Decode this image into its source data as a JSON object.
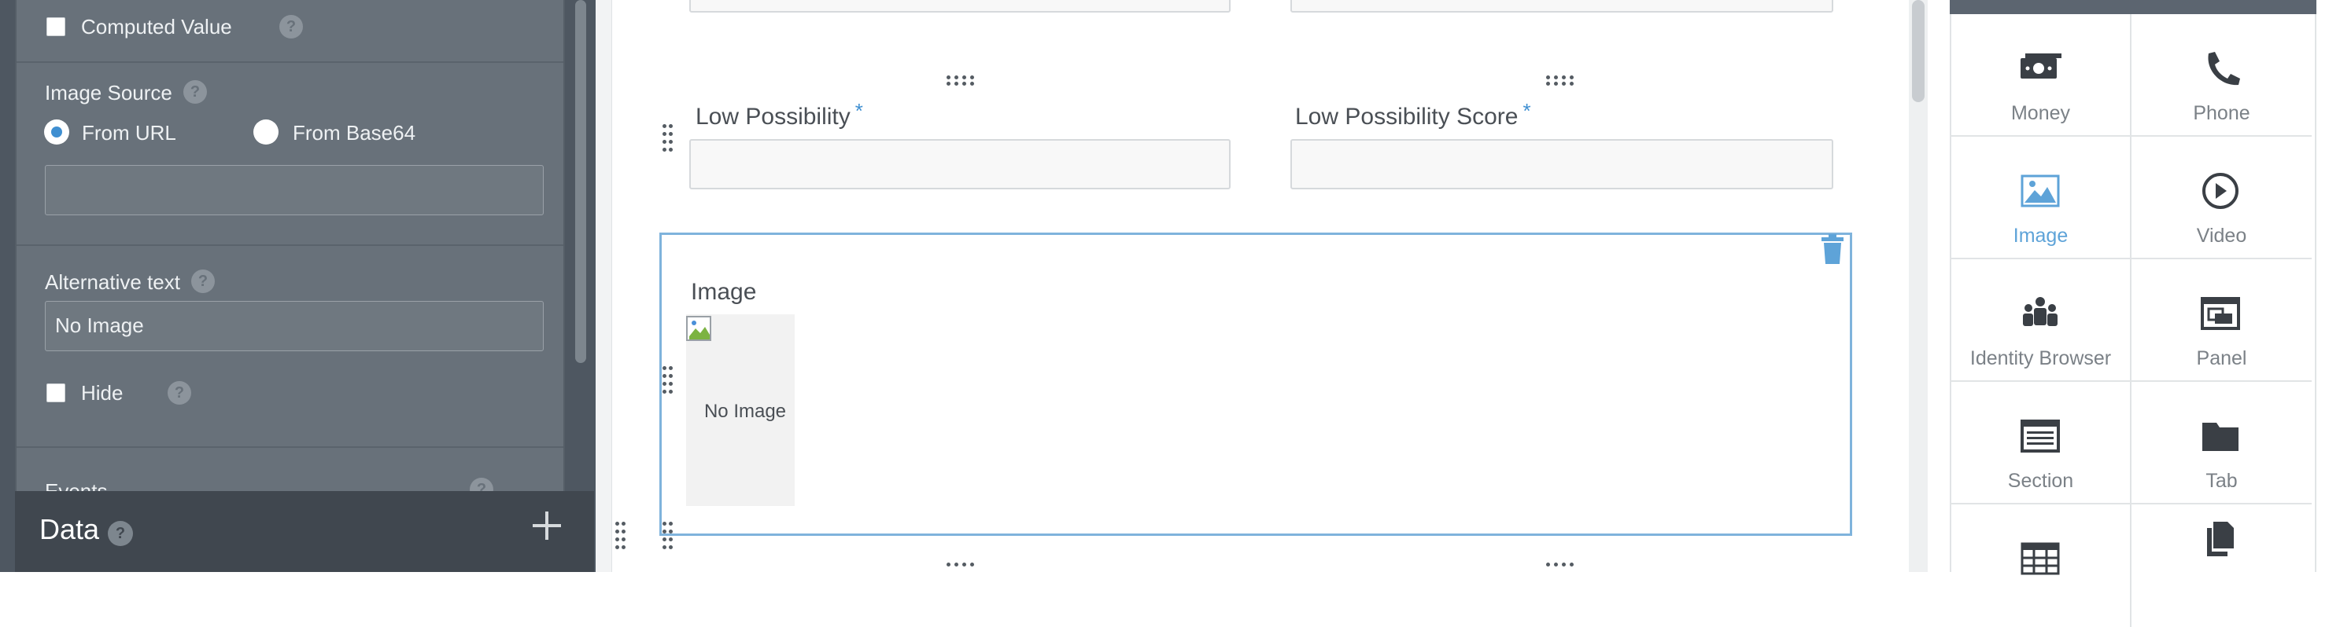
{
  "left_panel": {
    "computed_value_label": "Computed Value",
    "image_source_label": "Image Source",
    "from_url_label": "From URL",
    "from_base64_label": "From Base64",
    "url_value": "",
    "alt_text_label": "Alternative text",
    "alt_text_value": "No Image",
    "hide_label": "Hide",
    "events_label": "Events",
    "help_glyph": "?"
  },
  "data_bar": {
    "title": "Data",
    "help_glyph": "?"
  },
  "canvas": {
    "fields": [
      {
        "label": "Low Possibility",
        "required_mark": "*"
      },
      {
        "label": "Low Possibility Score",
        "required_mark": "*"
      }
    ],
    "image_widget": {
      "label": "Image",
      "placeholder_text": "No Image"
    }
  },
  "palette": {
    "tiles": [
      {
        "label": "Money",
        "icon": "money-icon"
      },
      {
        "label": "Phone",
        "icon": "phone-icon"
      },
      {
        "label": "Image",
        "icon": "image-icon",
        "active": true
      },
      {
        "label": "Video",
        "icon": "video-icon"
      },
      {
        "label": "Identity Browser",
        "icon": "identity-browser-icon"
      },
      {
        "label": "Panel",
        "icon": "panel-icon"
      },
      {
        "label": "Section",
        "icon": "section-icon"
      },
      {
        "label": "Tab",
        "icon": "tab-icon"
      },
      {
        "label": "",
        "icon": "table-icon"
      },
      {
        "label": "",
        "icon": "copy-icon"
      }
    ]
  },
  "colors": {
    "accent": "#3f8fd1",
    "panel_dark": "#4e5761",
    "panel": "#68717a",
    "selection_border": "#7fb3dc",
    "active_tile": "#5ea3d8"
  }
}
